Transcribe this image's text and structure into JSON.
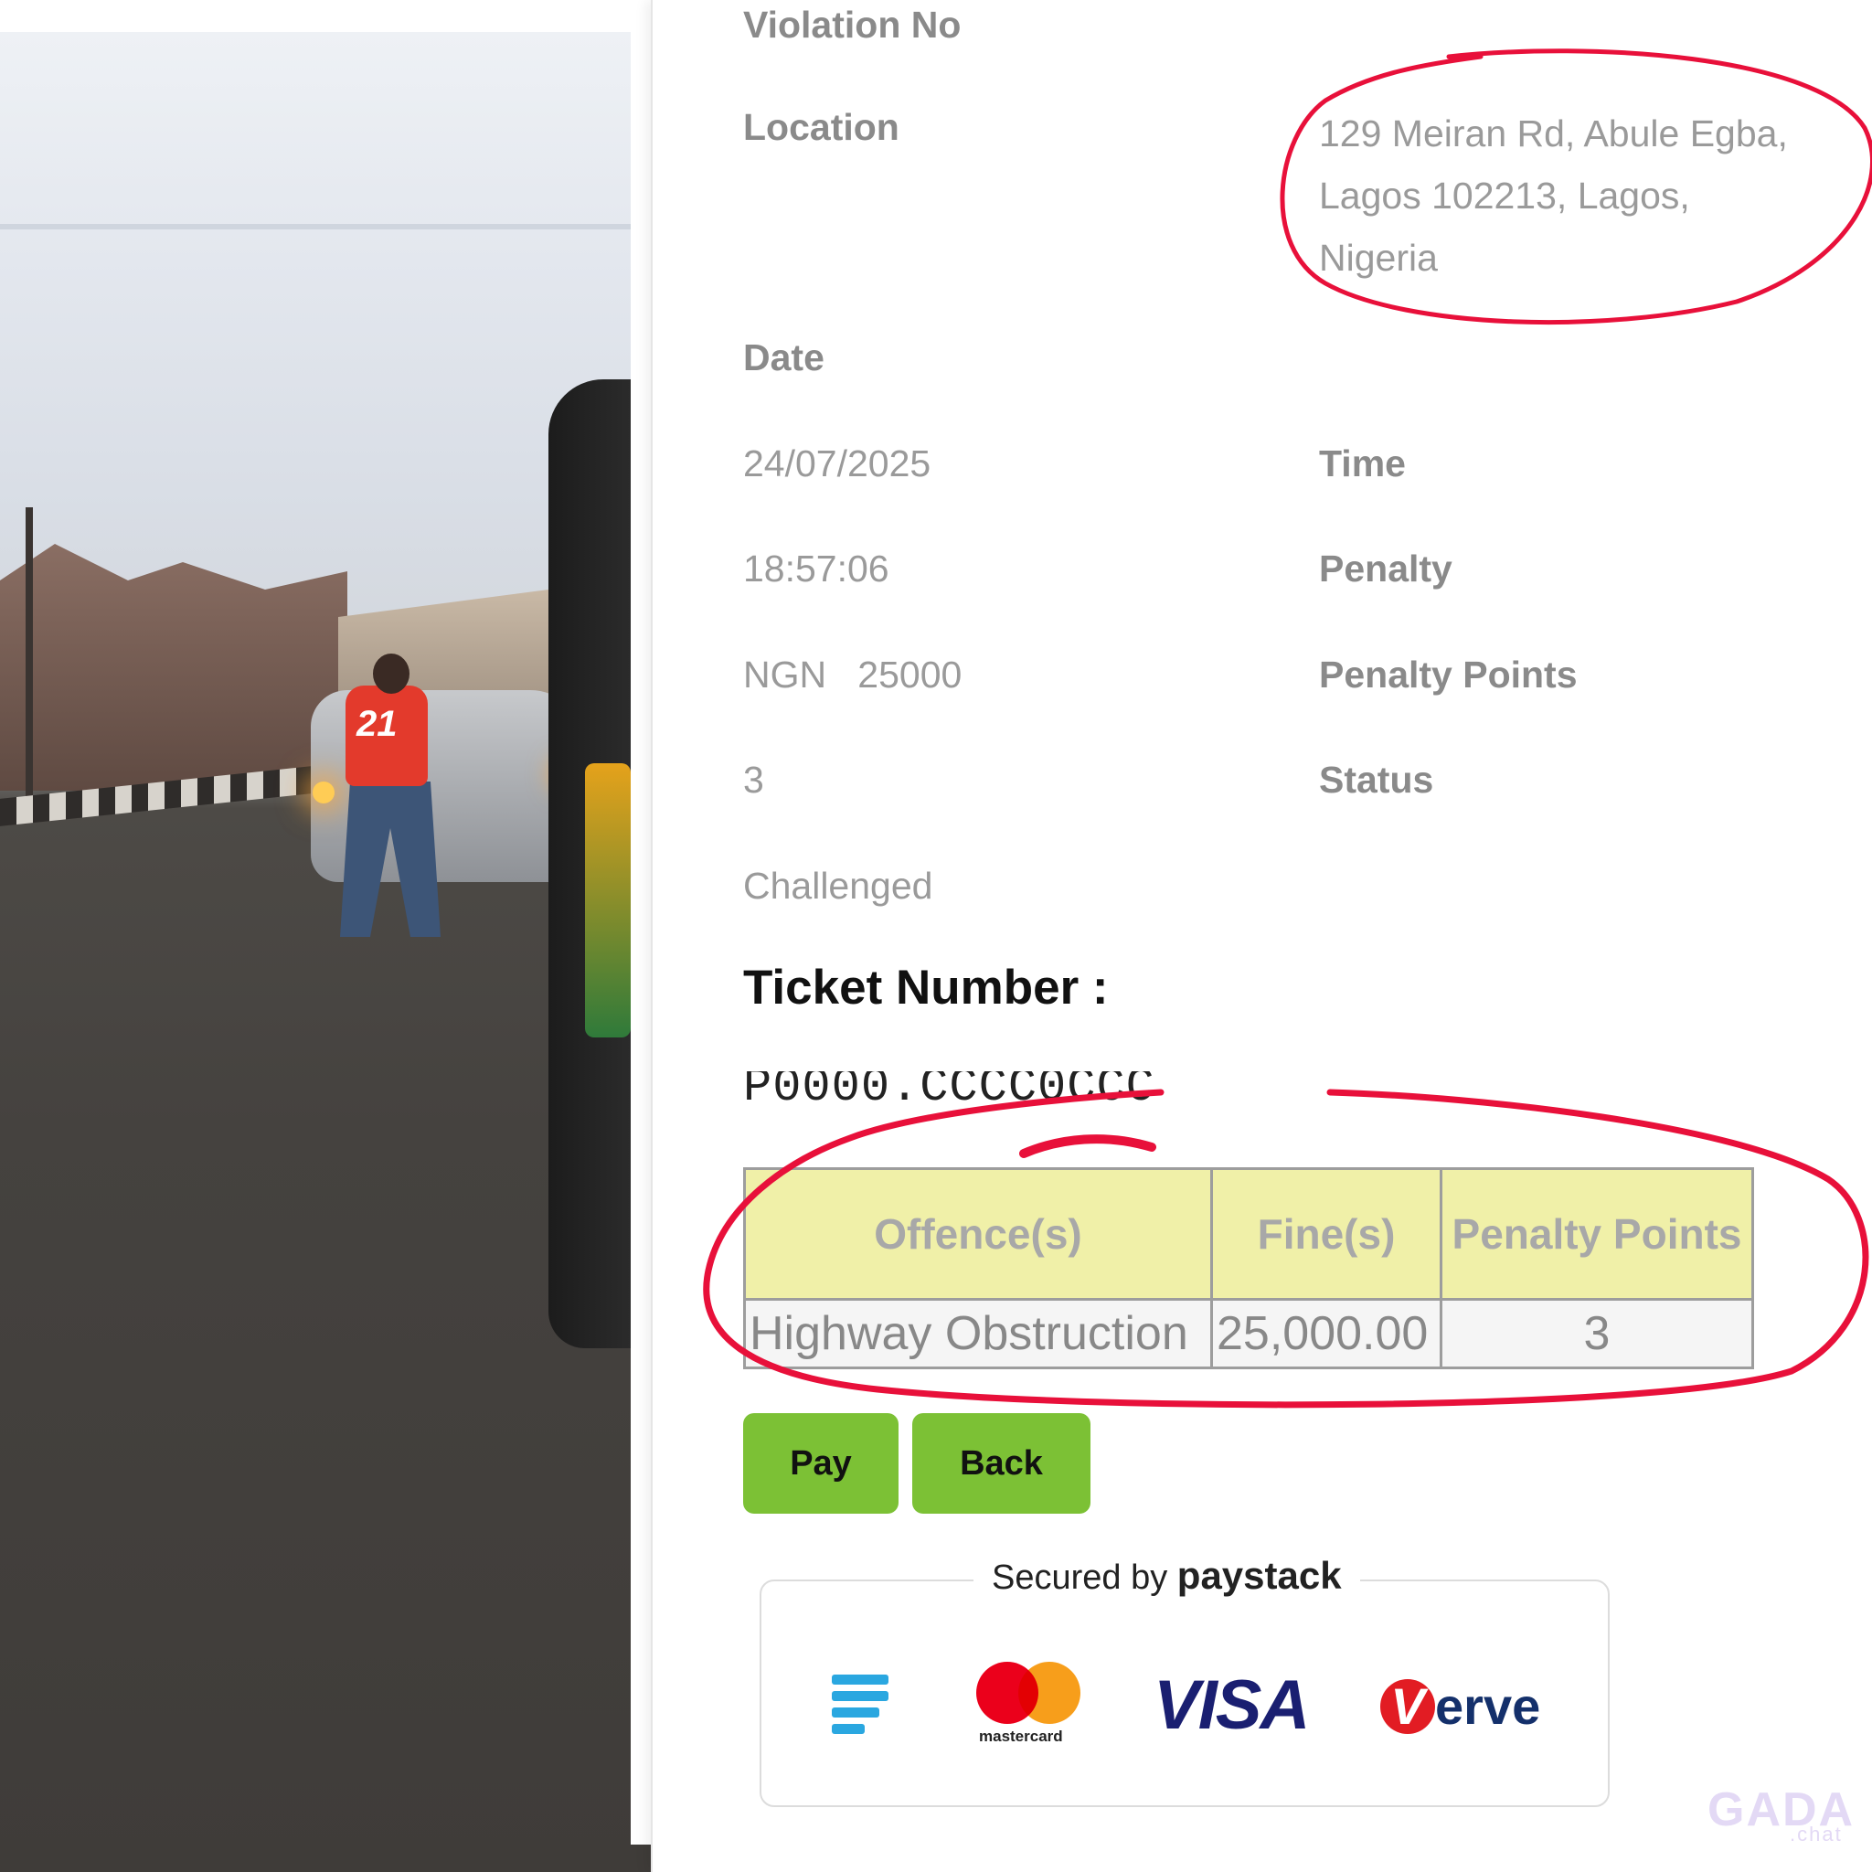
{
  "photo": {
    "description_icon": "photo-icon",
    "jersey_number": "21"
  },
  "violation": {
    "violation_no_label": "Violation No",
    "location_label": "Location",
    "location_lines": [
      "129 Meiran Rd, Abule Egba,",
      "Lagos 102213, Lagos,",
      "Nigeria"
    ],
    "date_label": "Date",
    "date_value": "24/07/2025",
    "time_label": "Time",
    "time_value": "18:57:06",
    "penalty_label": "Penalty",
    "penalty_value": "NGN   25000",
    "penalty_points_label": "Penalty Points",
    "penalty_points_value": "3",
    "status_label": "Status",
    "status_value": "Challenged"
  },
  "ticket": {
    "title": "Ticket Number :",
    "number": "P0000.CCCC0CCC"
  },
  "offences_table": {
    "headers": [
      "Offence(s)",
      "Fine(s)",
      "Penalty Points"
    ],
    "rows": [
      [
        "Highway Obstruction",
        "25,000.00",
        "3"
      ]
    ],
    "header_bg": "#f0f0a8"
  },
  "actions": {
    "pay_label": "Pay",
    "back_label": "Back",
    "button_color": "#7cc135"
  },
  "payment": {
    "secured_by": "Secured by",
    "brand": "paystack",
    "logos": {
      "paystack_icon": "paystack-icon",
      "mastercard_text": "mastercard",
      "visa_text": "VISA",
      "verve_v": "V",
      "verve_text": "erve"
    }
  },
  "watermark": {
    "main": "GADA",
    "sub": ".chat"
  },
  "annotation_color": "#e8103a"
}
